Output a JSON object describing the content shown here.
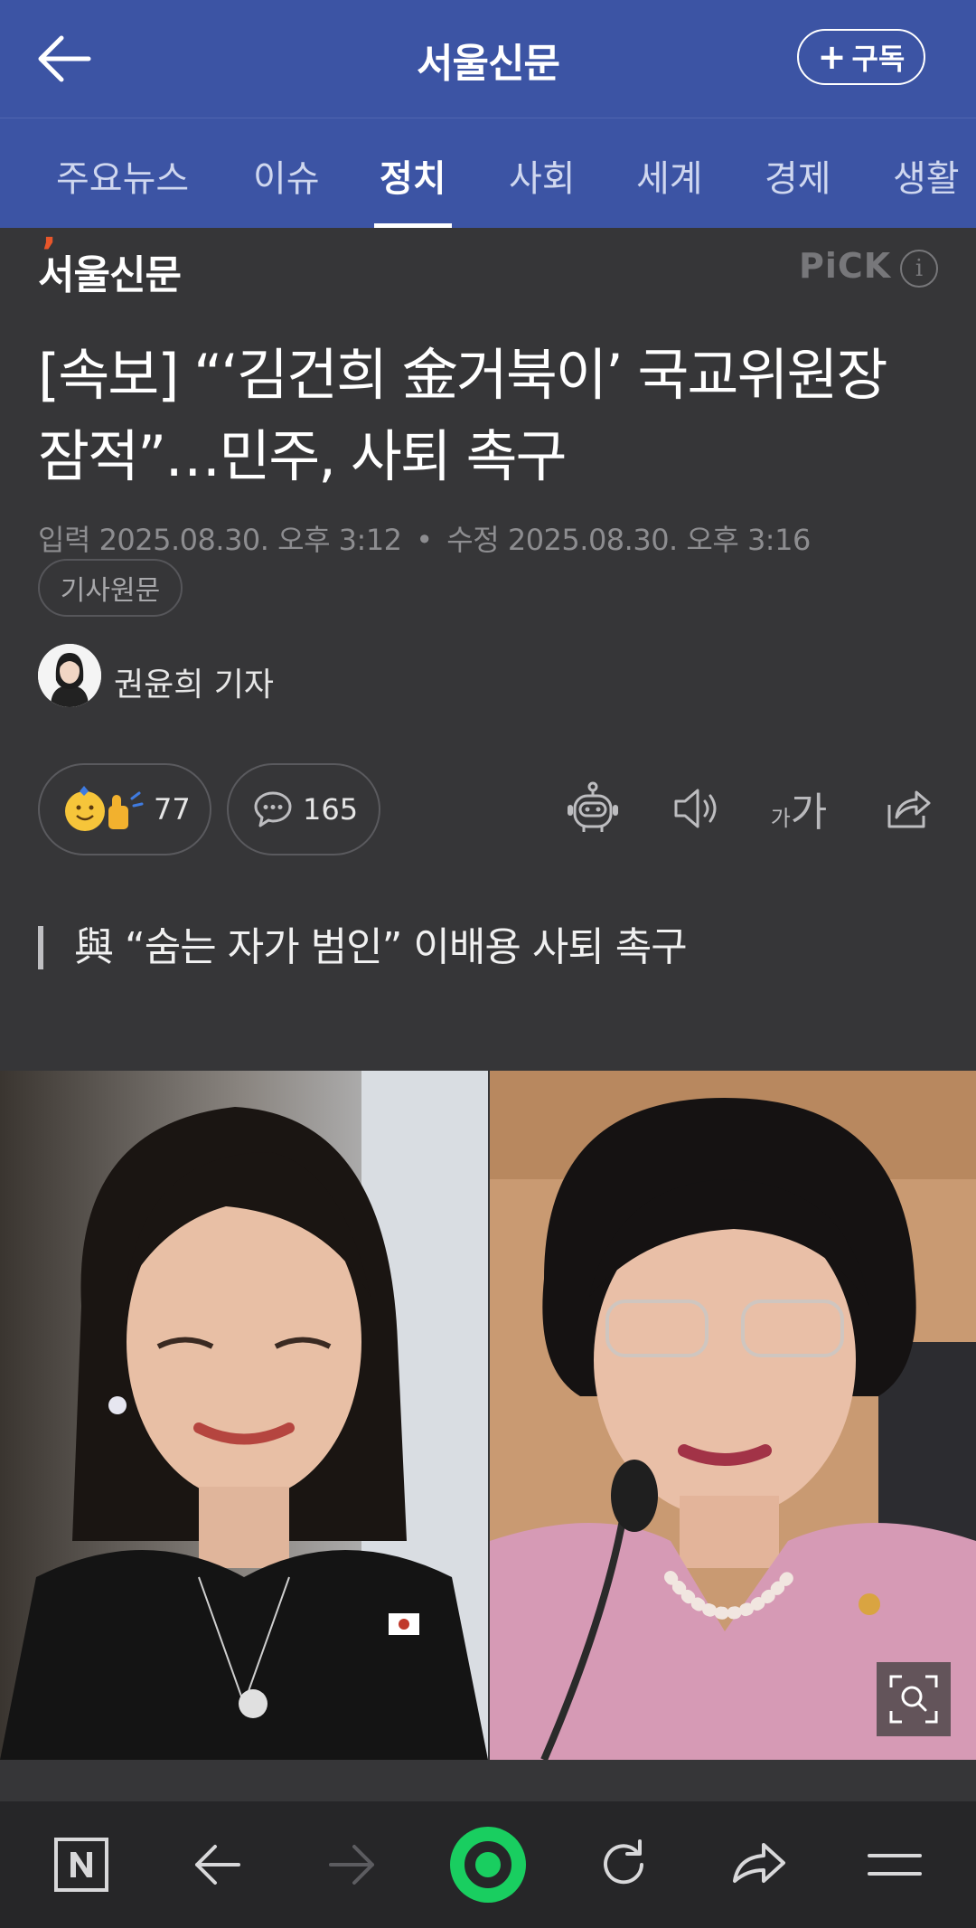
{
  "header": {
    "title": "서울신문",
    "subscribe_label": "구독"
  },
  "tabs": [
    {
      "label": "주요뉴스"
    },
    {
      "label": "이슈"
    },
    {
      "label": "정치",
      "active": true
    },
    {
      "label": "사회"
    },
    {
      "label": "세계"
    },
    {
      "label": "경제"
    },
    {
      "label": "생활"
    }
  ],
  "article": {
    "press_name": "서울신문",
    "pick_label": "PiCK",
    "headline": "[속보] “‘김건희 金거북이’ 국교위원장 잠적”…민주, 사퇴 촉구",
    "input_label": "입력",
    "input_time": "2025.08.30. 오후 3:12",
    "edit_label": "수정",
    "edit_time": "2025.08.30. 오후 3:16",
    "origin_button": "기사원문",
    "reporter": "권윤희 기자",
    "reaction_count": "77",
    "comment_count": "165",
    "subheadline": "與 “숨는 자가 범인” 이배용 사퇴 촉구"
  },
  "icons": {
    "back": "arrow-left-icon",
    "robot": "robot-summary-icon",
    "speaker": "speaker-icon",
    "font": "font-size-icon",
    "share": "share-icon",
    "zoom": "zoom-search-icon"
  },
  "bottom_nav": [
    "naver-home-icon",
    "back-arrow-icon",
    "forward-arrow-icon",
    "green-dot-icon",
    "refresh-icon",
    "share-arrow-icon",
    "menu-icon"
  ],
  "colors": {
    "brand_blue": "#3c54a4",
    "background": "#363638",
    "bottom_bar": "#262628",
    "green_dot": "#19ce60"
  }
}
